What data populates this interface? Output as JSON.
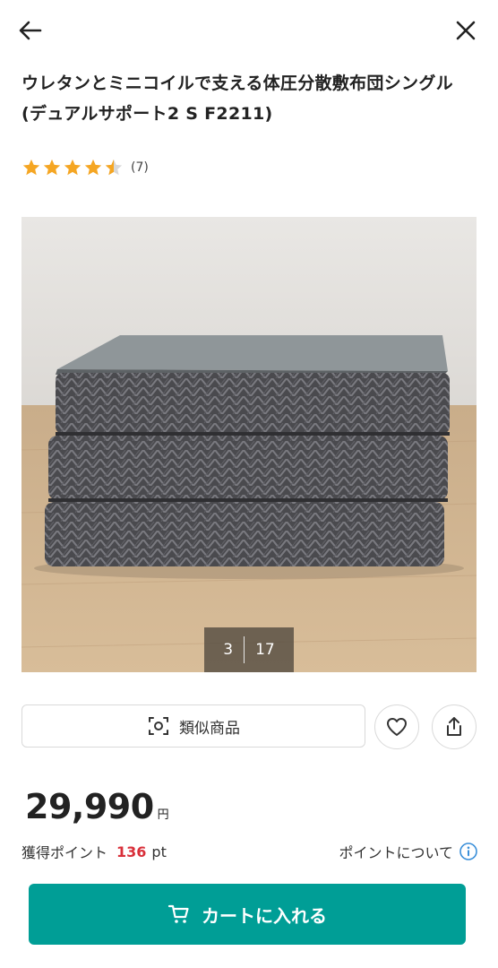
{
  "header": {
    "back_icon": "arrow-left-icon",
    "close_icon": "close-icon"
  },
  "product": {
    "title": "ウレタンとミニコイルで支える体圧分散敷布団シングル(デュアルサポート2 S F2211)",
    "rating": {
      "stars": 4.5,
      "max_stars": 5,
      "review_count": "(7)",
      "star_color": "#f5a623"
    },
    "gallery": {
      "current": "3",
      "total": "17"
    },
    "actions": {
      "similar_label": "類似商品",
      "similar_icon": "camera-scan-icon",
      "favorite_icon": "heart-icon",
      "share_icon": "share-icon"
    },
    "price": {
      "value": "29,990",
      "unit": "円"
    },
    "points": {
      "label": "獲得ポイント",
      "value": "136",
      "unit": "pt",
      "link_label": "ポイントについて",
      "info_icon": "info-icon",
      "value_color": "#d9303a"
    },
    "cart": {
      "label": "カートに入れる",
      "icon": "cart-icon",
      "color": "#009e96"
    }
  }
}
